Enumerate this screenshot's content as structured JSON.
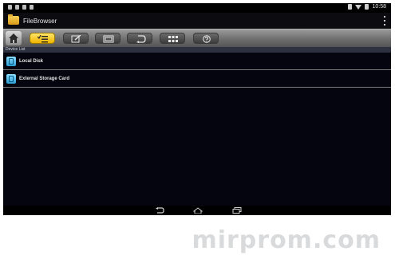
{
  "status_bar": {
    "time": "10:58",
    "left_icons": [
      "notification-icon",
      "notification-icon",
      "notification-icon",
      "notification-icon"
    ],
    "right_icons": [
      "bluetooth-icon",
      "wifi-icon",
      "battery-icon"
    ]
  },
  "app": {
    "title": "FileBrowser",
    "icon": "folder-icon"
  },
  "toolbar": {
    "buttons": [
      {
        "icon": "home-icon"
      },
      {
        "icon": "checklist-icon",
        "active": true
      },
      {
        "icon": "edit-icon"
      },
      {
        "icon": "window-icon"
      },
      {
        "icon": "undo-arrow-icon"
      },
      {
        "icon": "grid-icon"
      },
      {
        "icon": "help-icon"
      }
    ],
    "active_color": "#f5c400"
  },
  "list": {
    "header": "Device List",
    "items": [
      {
        "label": "Local Disk",
        "icon": "sd-card-icon"
      },
      {
        "label": "External Storage Card",
        "icon": "sd-card-icon"
      }
    ]
  },
  "nav_bar": {
    "icons": [
      "back-icon",
      "home-nav-icon",
      "recent-apps-icon"
    ]
  },
  "watermark": {
    "text": "mirprom.com"
  }
}
